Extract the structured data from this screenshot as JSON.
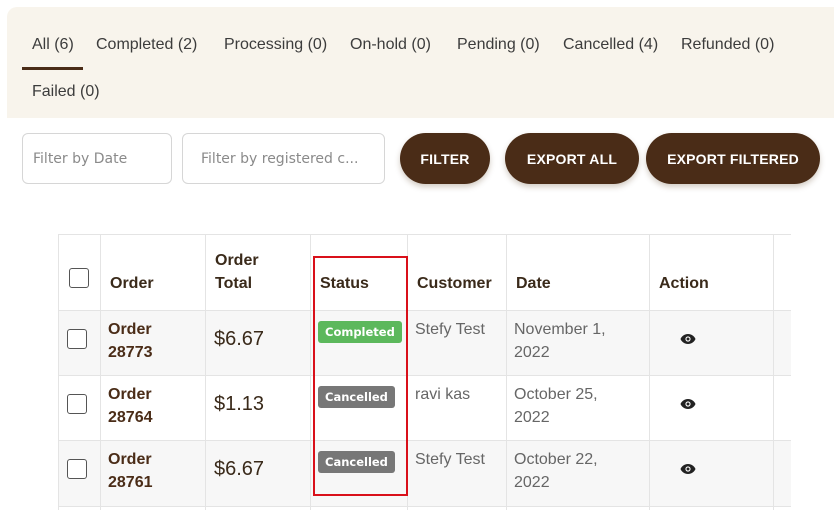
{
  "tabs": [
    {
      "label": "All (6)"
    },
    {
      "label": "Completed (2)"
    },
    {
      "label": "Processing (0)"
    },
    {
      "label": "On-hold (0)"
    },
    {
      "label": "Pending (0)"
    },
    {
      "label": "Cancelled (4)"
    },
    {
      "label": "Refunded (0)"
    },
    {
      "label": "Failed (0)"
    }
  ],
  "filters": {
    "date_placeholder": "Filter by Date",
    "customer_placeholder": "Filter by registered c...",
    "filter_label": "FILTER",
    "export_all_label": "EXPORT ALL",
    "export_filtered_label": "EXPORT FILTERED"
  },
  "table": {
    "headers": {
      "order": "Order",
      "order_total_line1": "Order",
      "order_total_line2": "Total",
      "status": "Status",
      "customer": "Customer",
      "date": "Date",
      "action": "Action"
    },
    "rows": [
      {
        "order_line1": "Order",
        "order_line2": "28773",
        "total": "$6.67",
        "status": "Completed",
        "customer": "Stefy Test",
        "date_line1": "November 1,",
        "date_line2": "2022"
      },
      {
        "order_line1": "Order",
        "order_line2": "28764",
        "total": "$1.13",
        "status": "Cancelled",
        "customer": "ravi kas",
        "date_line1": "October 25,",
        "date_line2": "2022"
      },
      {
        "order_line1": "Order",
        "order_line2": "28761",
        "total": "$6.67",
        "status": "Cancelled",
        "customer": "Stefy Test",
        "date_line1": "October 22,",
        "date_line2": "2022"
      }
    ]
  },
  "colors": {
    "brand": "#4a2c17",
    "completed": "#5cb85c",
    "cancelled": "#777777",
    "highlight": "#d9101a"
  }
}
